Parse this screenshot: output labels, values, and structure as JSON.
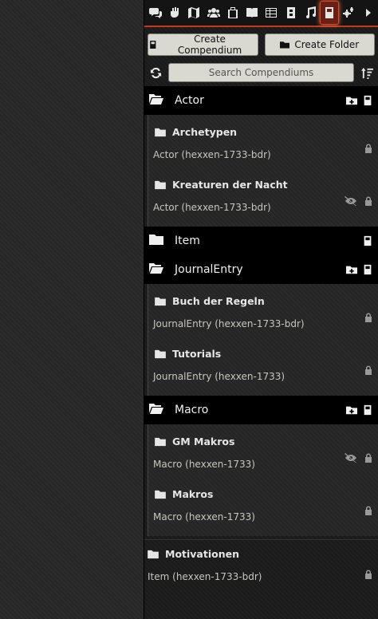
{
  "tabs": [
    {
      "name": "chat-tab",
      "icon": "comments-icon"
    },
    {
      "name": "combat-tab",
      "icon": "fist-icon"
    },
    {
      "name": "scenes-tab",
      "icon": "map-icon"
    },
    {
      "name": "actors-tab",
      "icon": "users-icon"
    },
    {
      "name": "items-tab",
      "icon": "suitcase-icon"
    },
    {
      "name": "journal-tab",
      "icon": "book-open-icon"
    },
    {
      "name": "tables-tab",
      "icon": "table-icon"
    },
    {
      "name": "cards-tab",
      "icon": "card-icon"
    },
    {
      "name": "playlists-tab",
      "icon": "music-icon"
    },
    {
      "name": "compendium-tab",
      "icon": "atlas-icon",
      "active": true
    },
    {
      "name": "settings-tab",
      "icon": "cogs-icon"
    },
    {
      "name": "collapse-sidebar",
      "icon": "caret-right-icon"
    }
  ],
  "actions": {
    "create_compendium": "Create Compendium",
    "create_folder": "Create Folder"
  },
  "search": {
    "placeholder": "Search Compendiums"
  },
  "folders": [
    {
      "name": "Actor",
      "packs": [
        {
          "title": "Archetypen",
          "meta": "Actor (hexxen-1733-bdr)",
          "hidden": false
        },
        {
          "title": "Kreaturen der Nacht",
          "meta": "Actor (hexxen-1733-bdr)",
          "hidden": true
        }
      ]
    },
    {
      "name": "Item",
      "packs": []
    },
    {
      "name": "JournalEntry",
      "packs": [
        {
          "title": "Buch der Regeln",
          "meta": "JournalEntry (hexxen-1733-bdr)",
          "hidden": false
        },
        {
          "title": "Tutorials",
          "meta": "JournalEntry (hexxen-1733)",
          "hidden": false
        }
      ]
    },
    {
      "name": "Macro",
      "packs": [
        {
          "title": "GM Makros",
          "meta": "Macro (hexxen-1733)",
          "hidden": true
        },
        {
          "title": "Makros",
          "meta": "Macro (hexxen-1733)",
          "hidden": false
        }
      ]
    }
  ],
  "standalone": {
    "title": "Motivationen",
    "meta": "Item (hexxen-1733-bdr)"
  },
  "colors": {
    "accent": "#c33a1e",
    "button_bg": "#d9d9d2"
  }
}
